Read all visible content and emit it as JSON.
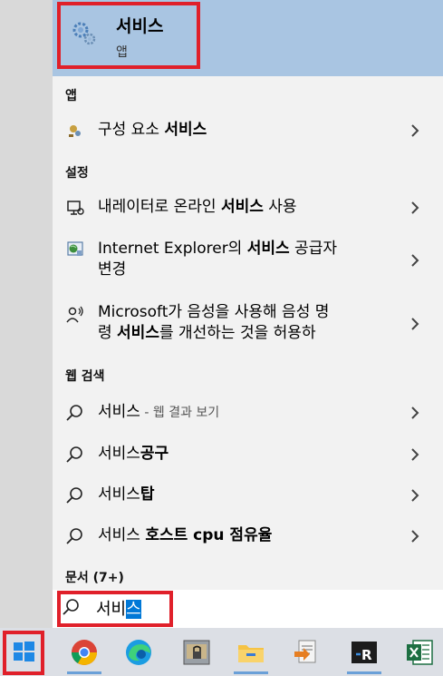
{
  "best_match": {
    "title": "서비스",
    "subtitle": "앱"
  },
  "sections": {
    "apps": "앱",
    "settings": "설정",
    "web": "웹 검색",
    "documents": "문서 (7+)"
  },
  "app_results": [
    {
      "prefix": "구성 요소 ",
      "bold": "서비스",
      "suffix": ""
    }
  ],
  "settings_results": [
    {
      "line1_pre": "내레이터로 온라인 ",
      "line1_bold": "서비스",
      "line1_post": " 사용",
      "line2": ""
    },
    {
      "line1_pre": "Internet Explorer의 ",
      "line1_bold": "서비스",
      "line1_post": " 공급자",
      "line2": "변경"
    },
    {
      "line1_pre": "Microsoft가 음성을 사용해 음성 명",
      "line1_bold": "",
      "line1_post": "",
      "line2_pre": "령 ",
      "line2_bold": "서비스",
      "line2_post": "를 개선하는 것을 허용하"
    }
  ],
  "web_results": [
    {
      "pre": "서비스",
      "bold": "",
      "muted": " - 웹 결과 보기"
    },
    {
      "pre": "서비스",
      "bold": "공구",
      "muted": ""
    },
    {
      "pre": "서비스",
      "bold": "탑",
      "muted": ""
    },
    {
      "pre": "서비스 ",
      "bold": "호스트 cpu 점유율",
      "muted": ""
    }
  ],
  "search": {
    "typed": "서비",
    "selected": "스"
  },
  "taskbar": {
    "icons": [
      "windows-start-icon",
      "chrome-icon",
      "edge-icon",
      "security-app-icon",
      "file-explorer-icon",
      "document-app-icon",
      "remote-app-icon",
      "excel-icon"
    ]
  }
}
